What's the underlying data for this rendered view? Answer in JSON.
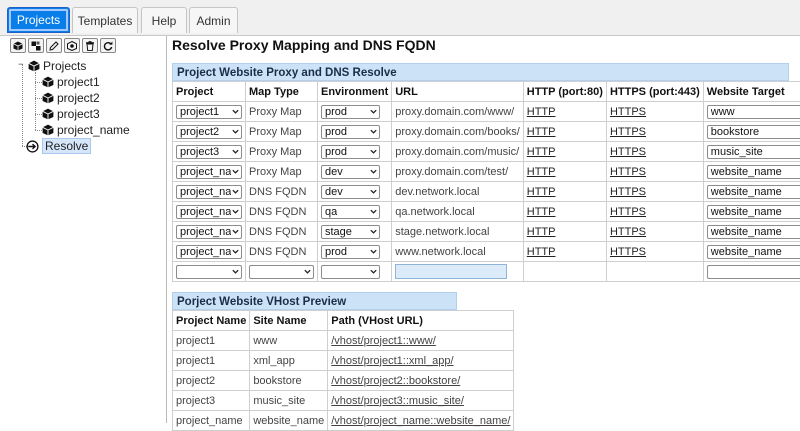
{
  "top_tabs": [
    {
      "label": "Projects",
      "active": true
    },
    {
      "label": "Templates",
      "active": false
    },
    {
      "label": "Help",
      "active": false
    },
    {
      "label": "Admin",
      "active": false
    }
  ],
  "toolbar": {
    "icons": [
      "cube-icon",
      "cubes-icon",
      "edit-icon",
      "settings-cube-icon",
      "trash-icon",
      "refresh-icon"
    ]
  },
  "tree": {
    "root_label": "Projects",
    "children": [
      "project1",
      "project2",
      "project3",
      "project_name"
    ],
    "resolve_label": "Resolve"
  },
  "page_title": "Resolve Proxy Mapping and DNS FQDN",
  "proxy_section": {
    "title": "Project Website Proxy and DNS Resolve",
    "headers": [
      "Project",
      "Map Type",
      "Environment",
      "URL",
      "HTTP (port:80)",
      "HTTPS (port:443)",
      "Website Target"
    ],
    "rows": [
      {
        "project": "project1",
        "map_type": "Proxy Map",
        "env": "prod",
        "url": "proxy.domain.com/www/",
        "http": "HTTP",
        "https": "HTTPS",
        "target": "www"
      },
      {
        "project": "project2",
        "map_type": "Proxy Map",
        "env": "prod",
        "url": "proxy.domain.com/books/",
        "http": "HTTP",
        "https": "HTTPS",
        "target": "bookstore"
      },
      {
        "project": "project3",
        "map_type": "Proxy Map",
        "env": "prod",
        "url": "proxy.domain.com/music/",
        "http": "HTTP",
        "https": "HTTPS",
        "target": "music_site"
      },
      {
        "project": "project_nam",
        "map_type": "Proxy Map",
        "env": "dev",
        "url": "proxy.domain.com/test/",
        "http": "HTTP",
        "https": "HTTPS",
        "target": "website_name"
      },
      {
        "project": "project_nam",
        "map_type": "DNS FQDN",
        "env": "dev",
        "url": "dev.network.local",
        "http": "HTTP",
        "https": "HTTPS",
        "target": "website_name"
      },
      {
        "project": "project_nam",
        "map_type": "DNS FQDN",
        "env": "qa",
        "url": "qa.network.local",
        "http": "HTTP",
        "https": "HTTPS",
        "target": "website_name"
      },
      {
        "project": "project_nam",
        "map_type": "DNS FQDN",
        "env": "stage",
        "url": "stage.network.local",
        "http": "HTTP",
        "https": "HTTPS",
        "target": "website_name"
      },
      {
        "project": "project_nam",
        "map_type": "DNS FQDN",
        "env": "prod",
        "url": "www.network.local",
        "http": "HTTP",
        "https": "HTTPS",
        "target": "website_name"
      }
    ]
  },
  "vhost_section": {
    "title": "Porject Website VHost Preview",
    "headers": [
      "Project Name",
      "Site Name",
      "Path (VHost URL)"
    ],
    "rows": [
      {
        "project": "project1",
        "site": "www",
        "path": "/vhost/project1::www/"
      },
      {
        "project": "project1",
        "site": "xml_app",
        "path": "/vhost/project1::xml_app/"
      },
      {
        "project": "project2",
        "site": "bookstore",
        "path": "/vhost/project2::bookstore/"
      },
      {
        "project": "project3",
        "site": "music_site",
        "path": "/vhost/project3::music_site/"
      },
      {
        "project": "project_name",
        "site": "website_name",
        "path": "/vhost/project_name::website_name/"
      }
    ]
  },
  "colors": {
    "active_tab": "#0a7ee8",
    "section_header": "#cce2f7",
    "url_input": "#dcebf9"
  }
}
